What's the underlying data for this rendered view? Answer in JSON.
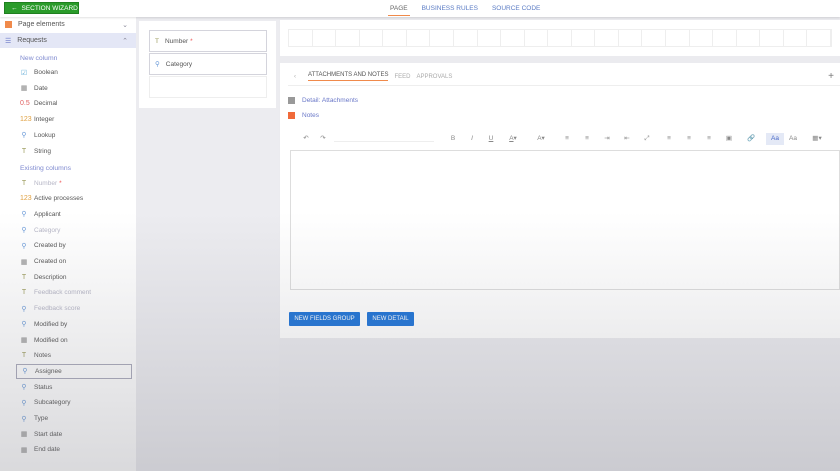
{
  "topbar": {
    "wizard_label": "SECTION WIZARD",
    "tabs": [
      "PAGE",
      "BUSINESS RULES",
      "SOURCE CODE"
    ]
  },
  "sidebar": {
    "page_elements": "Page elements",
    "requests": "Requests",
    "new_column": "New column",
    "new_items": [
      {
        "label": "Boolean",
        "icon": "checkbox-icon"
      },
      {
        "label": "Date",
        "icon": "calendar-icon"
      },
      {
        "label": "Decimal",
        "icon": "decimal-icon"
      },
      {
        "label": "Integer",
        "icon": "integer-icon"
      },
      {
        "label": "Lookup",
        "icon": "search-icon"
      },
      {
        "label": "String",
        "icon": "text-icon"
      }
    ],
    "existing_columns": "Existing columns",
    "existing_items": [
      {
        "label": "Number",
        "icon": "text-icon",
        "disabled": true,
        "required": "*"
      },
      {
        "label": "Active processes",
        "icon": "integer-icon"
      },
      {
        "label": "Applicant",
        "icon": "search-icon"
      },
      {
        "label": "Category",
        "icon": "search-icon",
        "disabled": true
      },
      {
        "label": "Created by",
        "icon": "search-icon"
      },
      {
        "label": "Created on",
        "icon": "calendar-icon"
      },
      {
        "label": "Description",
        "icon": "text-icon"
      },
      {
        "label": "Feedback comment",
        "icon": "text-icon",
        "disabled": true
      },
      {
        "label": "Feedback score",
        "icon": "search-icon",
        "disabled": true
      },
      {
        "label": "Modified by",
        "icon": "search-icon"
      },
      {
        "label": "Modified on",
        "icon": "calendar-icon"
      },
      {
        "label": "Notes",
        "icon": "text-icon"
      },
      {
        "label": "Assignee",
        "icon": "search-icon",
        "selected": true
      },
      {
        "label": "Status",
        "icon": "search-icon"
      },
      {
        "label": "Subcategory",
        "icon": "search-icon"
      },
      {
        "label": "Type",
        "icon": "search-icon"
      },
      {
        "label": "Start date",
        "icon": "calendar-icon"
      },
      {
        "label": "End date",
        "icon": "calendar-icon"
      }
    ]
  },
  "card": {
    "number": "Number",
    "required": "*",
    "category": "Category"
  },
  "detail": {
    "tabs": [
      "ATTACHMENTS AND NOTES",
      "FEED",
      "APPROVALS"
    ],
    "attachments": "Detail: Attachments",
    "notes": "Notes",
    "toolbar": [
      "undo-icon",
      "redo-icon",
      "bold-icon",
      "italic-icon",
      "underline-icon",
      "font-color-icon",
      "highlight-icon",
      "numbered-list-icon",
      "bullet-list-icon",
      "indent-icon",
      "outdent-icon",
      "fullscreen-icon",
      "align-left-icon",
      "align-center-icon",
      "align-right-icon",
      "image-icon",
      "link-icon",
      "font-size-icon",
      "font-family-icon",
      "table-icon"
    ],
    "toolbar_text": {
      "bold": "B",
      "italic": "I",
      "underline": "U",
      "aa1": "Aa",
      "aa2": "Aa"
    }
  },
  "buttons": {
    "new_fields_group": "NEW FIELDS GROUP",
    "new_detail": "NEW DETAIL"
  },
  "colors": {
    "accent": "#f08a4b",
    "primary": "#1e74d8",
    "wizard": "#2a9b2a"
  }
}
